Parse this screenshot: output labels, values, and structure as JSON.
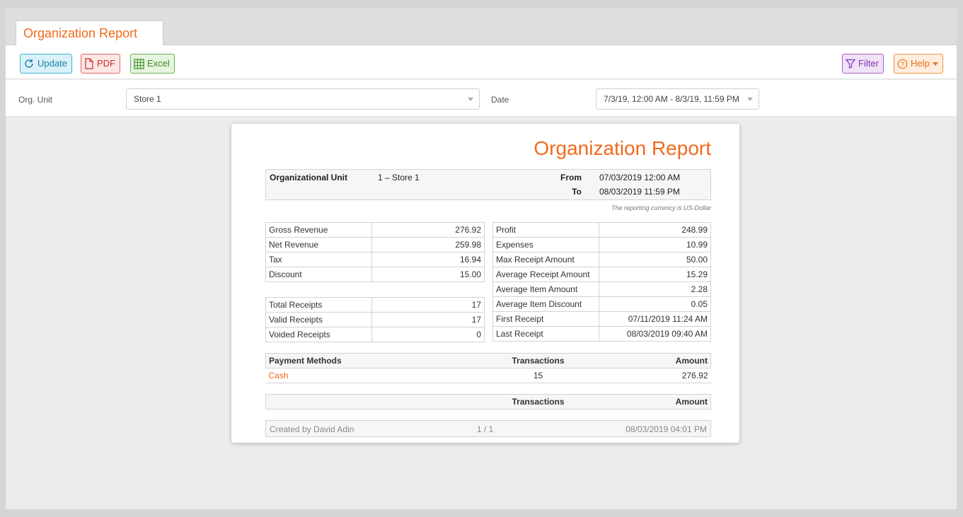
{
  "tab": {
    "title": "Organization Report"
  },
  "toolbar": {
    "update": "Update",
    "pdf": "PDF",
    "excel": "Excel",
    "filter": "Filter",
    "help": "Help"
  },
  "params": {
    "org_unit_label": "Org. Unit",
    "org_unit_value": "Store 1",
    "date_label": "Date",
    "date_value": "7/3/19, 12:00 AM - 8/3/19, 11:59 PM"
  },
  "report": {
    "title": "Organization Report",
    "org_unit_label": "Organizational Unit",
    "org_unit_value": "1 – Store 1",
    "from_label": "From",
    "from_value": "07/03/2019 12:00 AM",
    "to_label": "To",
    "to_value": "08/03/2019 11:59 PM",
    "currency_note": "The reporting currency is US-Dollar",
    "left_a": [
      {
        "label": "Gross Revenue",
        "value": "276.92"
      },
      {
        "label": "Net Revenue",
        "value": "259.98"
      },
      {
        "label": "Tax",
        "value": "16.94"
      },
      {
        "label": "Discount",
        "value": "15.00"
      }
    ],
    "left_b": [
      {
        "label": "Total Receipts",
        "value": "17"
      },
      {
        "label": "Valid Receipts",
        "value": "17"
      },
      {
        "label": "Voided Receipts",
        "value": "0"
      }
    ],
    "right": [
      {
        "label": "Profit",
        "value": "248.99"
      },
      {
        "label": "Expenses",
        "value": "10.99"
      },
      {
        "label": "Max Receipt Amount",
        "value": "50.00"
      },
      {
        "label": "Average Receipt Amount",
        "value": "15.29"
      },
      {
        "label": "Average Item Amount",
        "value": "2.28"
      },
      {
        "label": "Average Item Discount",
        "value": "0.05"
      },
      {
        "label": "First Receipt",
        "value": "07/11/2019 11:24 AM"
      },
      {
        "label": "Last Receipt",
        "value": "08/03/2019 09:40 AM"
      }
    ],
    "payments": {
      "header": {
        "name": "Payment Methods",
        "transactions": "Transactions",
        "amount": "Amount"
      },
      "rows": [
        {
          "name": "Cash",
          "transactions": "15",
          "amount": "276.92"
        }
      ]
    },
    "second_table": {
      "name": "",
      "transactions": "Transactions",
      "amount": "Amount"
    },
    "footer": {
      "created_by": "Created by David Adin",
      "page": "1 / 1",
      "timestamp": "08/03/2019 04:01 PM"
    }
  }
}
